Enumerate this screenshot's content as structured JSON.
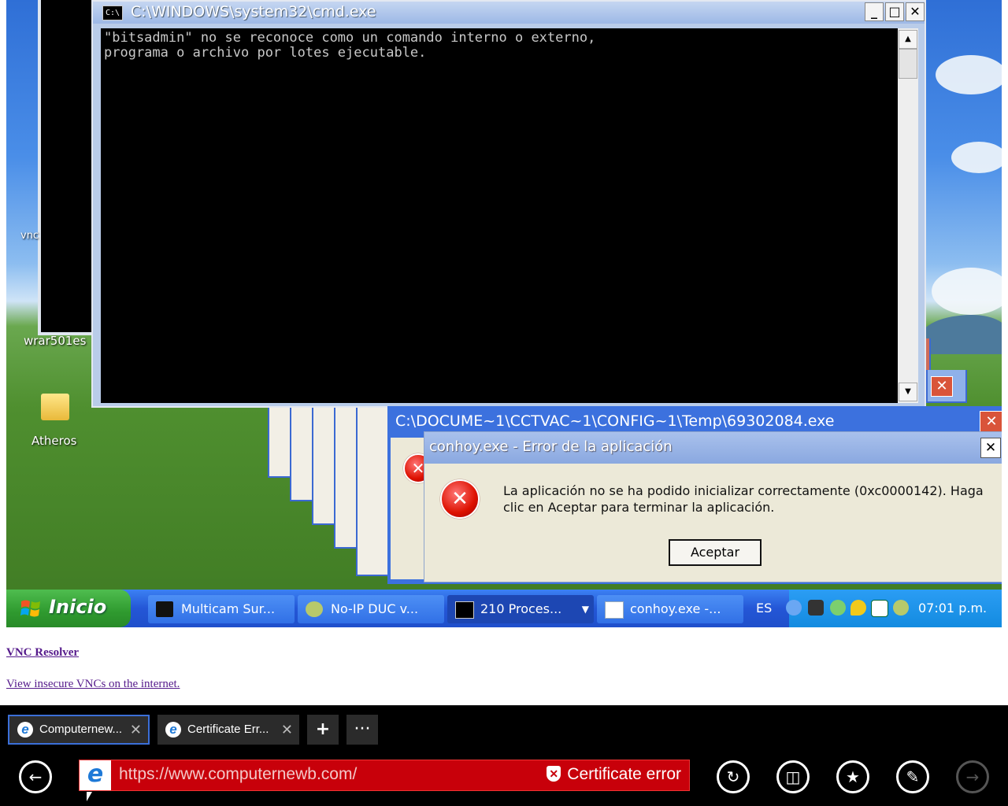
{
  "remote": {
    "desktop_icons": [
      "vnc",
      "wrar501es",
      "Atheros"
    ],
    "cmd": {
      "title": "C:\\WINDOWS\\system32\\cmd.exe",
      "icon_text": "C:\\",
      "output": "\"bitsadmin\" no se reconoce como un comando interno o externo,\nprograma o archivo por lotes ejecutable."
    },
    "error_back": {
      "title": "C:\\DOCUME~1\\CCTVAC~1\\CONFIG~1\\Temp\\69302084.exe"
    },
    "error_dialog": {
      "title": "conhoy.exe - Error de la aplicación",
      "message": "La aplicación no se ha podido inicializar correctamente (0xc0000142). Haga clic en Aceptar para terminar la aplicación.",
      "ok_label": "Aceptar"
    },
    "taskbar": {
      "start_label": "Inicio",
      "items": [
        {
          "label": "Multicam Sur..."
        },
        {
          "label": "No-IP DUC v..."
        },
        {
          "label": "210 Proces..."
        },
        {
          "label": "conhoy.exe -..."
        }
      ],
      "lang": "ES",
      "clock": "07:01 p.m."
    }
  },
  "page": {
    "link1": "VNC Resolver",
    "link2": "View insecure VNCs on the internet."
  },
  "browser": {
    "tabs": [
      {
        "label": "Computernew..."
      },
      {
        "label": "Certificate Err..."
      }
    ],
    "new_tab_label": "+",
    "more_label": "···",
    "url": "https://www.computernewb.com/",
    "cert_label": "Certificate error"
  }
}
